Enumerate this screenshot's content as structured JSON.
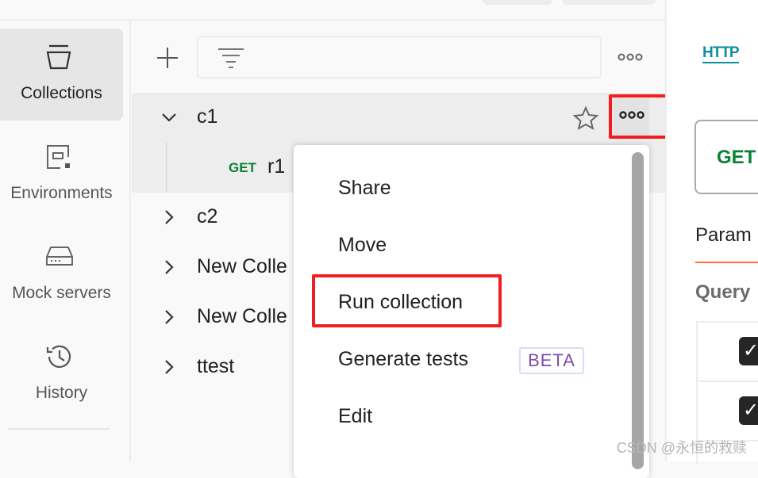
{
  "sidebar": {
    "items": [
      {
        "label": "Collections",
        "icon": "collections-icon",
        "active": true
      },
      {
        "label": "Environments",
        "icon": "environments-icon"
      },
      {
        "label": "Mock servers",
        "icon": "mock-servers-icon"
      },
      {
        "label": "History",
        "icon": "history-icon"
      }
    ]
  },
  "list": {
    "search_placeholder": "",
    "collections": [
      {
        "name": "c1",
        "expanded": true,
        "requests": [
          {
            "method": "GET",
            "name": "r1"
          }
        ]
      },
      {
        "name": "c2"
      },
      {
        "name": "New Colle"
      },
      {
        "name": "New Colle"
      },
      {
        "name": "ttest"
      }
    ]
  },
  "menu": {
    "items": [
      "Share",
      "Move",
      "Run collection",
      "Generate tests",
      "Edit"
    ],
    "badge": "BETA"
  },
  "request": {
    "protocol_icon": "HTTP",
    "method": "GET",
    "tab": "Param",
    "section": "Query"
  },
  "watermark": "CSDN @永恒的救赎",
  "colors": {
    "accent": "#ff6c37",
    "get": "#0a8235",
    "highlight": "#f41d1d",
    "beta": "#7e4ea8",
    "http": "#0f8ea0"
  }
}
